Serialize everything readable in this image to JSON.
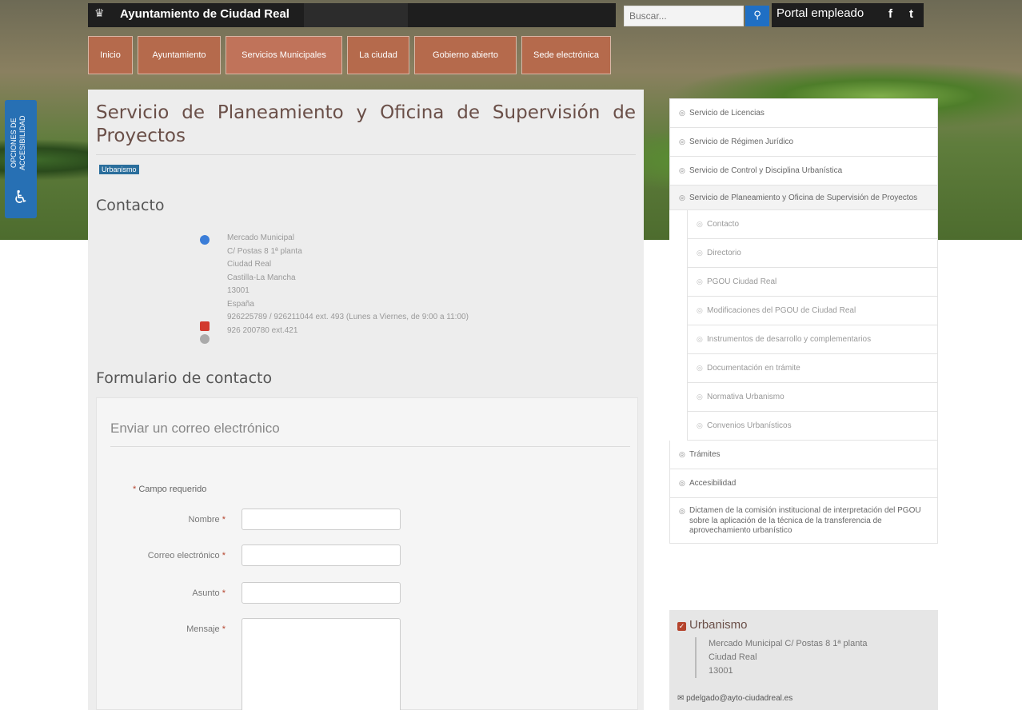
{
  "header": {
    "site_name": "Ayuntamiento de Ciudad Real",
    "search_placeholder": "Buscar...",
    "portal_label": "Portal empleado",
    "facebook": "f",
    "twitter": "t"
  },
  "nav": [
    "Inicio",
    "Ayuntamiento",
    "Servicios Municipales",
    "La ciudad",
    "Gobierno abierto",
    "Sede electrónica"
  ],
  "accessibility": {
    "label": "OPCIONES DE ACCESIBILIDAD"
  },
  "page": {
    "title": "Servicio de Planeamiento y Oficina de Supervisión de Proyectos",
    "tag": "Urbanismo",
    "contact_heading": "Contacto",
    "contact": {
      "address": [
        "Mercado Municipal",
        "C/ Postas 8 1ª planta",
        "Ciudad Real",
        "Castilla-La Mancha",
        "13001",
        "España"
      ],
      "phone": "926225789 / 926211044 ext. 493 (Lunes a Viernes, de 9:00 a 11:00)",
      "fax": "926 200780 ext.421"
    },
    "form_heading": "Formulario de contacto",
    "form": {
      "legend": "Enviar un correo electrónico",
      "required_note": "Campo requerido",
      "fields": [
        "Nombre",
        "Correo electrónico",
        "Asunto",
        "Mensaje"
      ]
    }
  },
  "sidebar": {
    "items": [
      "Servicio de Licencias",
      "Servicio de Régimen Jurídico",
      "Servicio de Control y Disciplina Urbanística",
      "Servicio de Planeamiento y Oficina de Supervisión de Proyectos"
    ],
    "subitems": [
      "Contacto",
      "Directorio",
      "PGOU Ciudad Real",
      "Modificaciones del PGOU de Ciudad Real",
      "Instrumentos de desarrollo y complementarios",
      "Documentación en trámite",
      "Normativa Urbanismo",
      "Convenios Urbanísticos"
    ],
    "items_after": [
      "Trámites",
      "Accesibilidad",
      "Dictamen de la comisión institucional de interpretación del PGOU sobre la aplicación de la técnica de la transferencia de aprovechamiento urbanístico"
    ]
  },
  "contact_card": {
    "title": "Urbanismo",
    "address": [
      "Mercado Municipal C/ Postas 8 1ª planta",
      "Ciudad Real",
      "13001"
    ],
    "email": "pdelgado@ayto-ciudadreal.es"
  }
}
